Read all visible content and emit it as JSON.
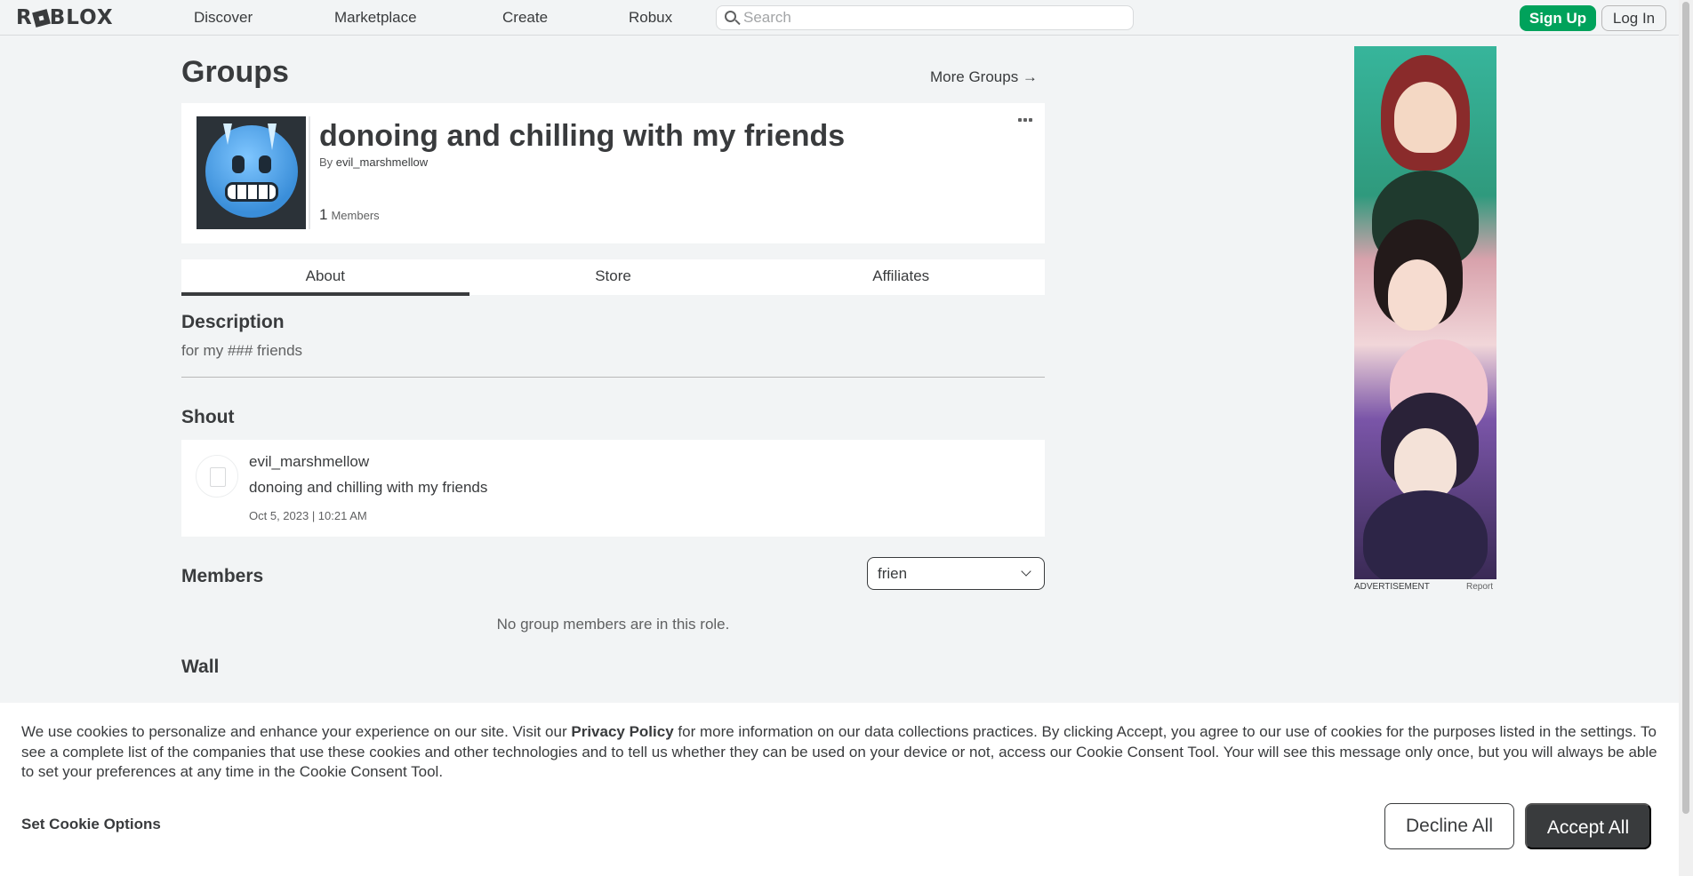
{
  "nav": {
    "logo": "ROBLOX",
    "links": [
      "Discover",
      "Marketplace",
      "Create",
      "Robux"
    ],
    "search_placeholder": "Search",
    "signup_label": "Sign Up",
    "login_label": "Log In"
  },
  "page": {
    "title": "Groups",
    "more_groups": "More Groups →"
  },
  "group": {
    "name": "donoing and chilling with my friends",
    "by_prefix": "By",
    "owner": "evil_marshmellow",
    "member_count": "1",
    "members_label": "Members"
  },
  "tabs": [
    {
      "label": "About",
      "active": true
    },
    {
      "label": "Store",
      "active": false
    },
    {
      "label": "Affiliates",
      "active": false
    }
  ],
  "description": {
    "heading": "Description",
    "text": "for my ### friends"
  },
  "shout": {
    "heading": "Shout",
    "user": "evil_marshmellow",
    "body": "donoing and chilling with my friends",
    "date": "Oct 5, 2023 | 10:21 AM"
  },
  "members": {
    "heading": "Members",
    "role_selected": "frien",
    "empty_text": "No group members are in this role."
  },
  "wall": {
    "heading": "Wall"
  },
  "ad": {
    "label": "ADVERTISEMENT",
    "report": "Report"
  },
  "cookie": {
    "text_before": "We use cookies to personalize and enhance your experience on our site. Visit our ",
    "privacy_link": "Privacy Policy",
    "text_after": " for more information on our data collections practices. By clicking Accept, you agree to our use of cookies for the purposes listed in the settings. To see a complete list of the companies that use these cookies and other technologies and to tell us whether they can be used on your device or not, access our Cookie Consent Tool. Your will see this message only once, but you will always be able to set your preferences at any time in the Cookie Consent Tool.",
    "options_label": "Set Cookie Options",
    "decline_label": "Decline All",
    "accept_label": "Accept All"
  },
  "colors": {
    "brand_green": "#00a25b",
    "text_dark": "#393b3d",
    "background": "#f2f4f5"
  }
}
